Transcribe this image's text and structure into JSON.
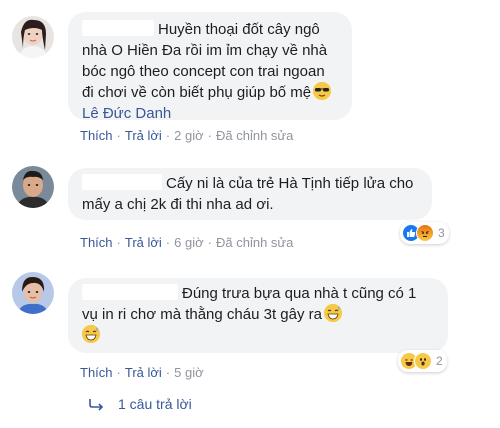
{
  "comments": [
    {
      "text": "Huyền thoại đốt cây ngô nhà O Hiền Đa rồi im ỉm chạy về nhà bóc ngô theo concept con trai ngoan đi chơi về còn biết phụ giúp bố mệ",
      "mention": "Lê Đức Danh",
      "like": "Thích",
      "reply": "Trả lời",
      "time": "2 giờ",
      "edited": "Đã chỉnh sửa"
    },
    {
      "text": "Cấy ni là của trẻ Hà Tịnh tiếp lửa cho mấy a chị 2k đi thi nha ad ơi.",
      "like": "Thích",
      "reply": "Trả lời",
      "time": "6 giờ",
      "edited": "Đã chỉnh sửa",
      "reaction_count": "3"
    },
    {
      "text": "Đúng trưa bựa qua nhà t cũng có 1 vụ in ri chơ mà thằng cháu 3t gây ra",
      "like": "Thích",
      "reply": "Trả lời",
      "time": "5 giờ",
      "reaction_count": "2"
    }
  ],
  "replies_link": "1 câu trả lời",
  "colors": {
    "link": "#385898",
    "bubble": "#f2f3f5",
    "meta": "#90949c",
    "like_blue": "#1877f2",
    "angry_orange": "#e9710f",
    "emoji_yellow": "#f7c948"
  },
  "icons": [
    "sunglasses-emoji-icon",
    "grin-sweat-emoji-icon",
    "like-reaction-icon",
    "angry-reaction-icon",
    "haha-reaction-icon",
    "wow-reaction-icon",
    "reply-arrow-icon"
  ]
}
